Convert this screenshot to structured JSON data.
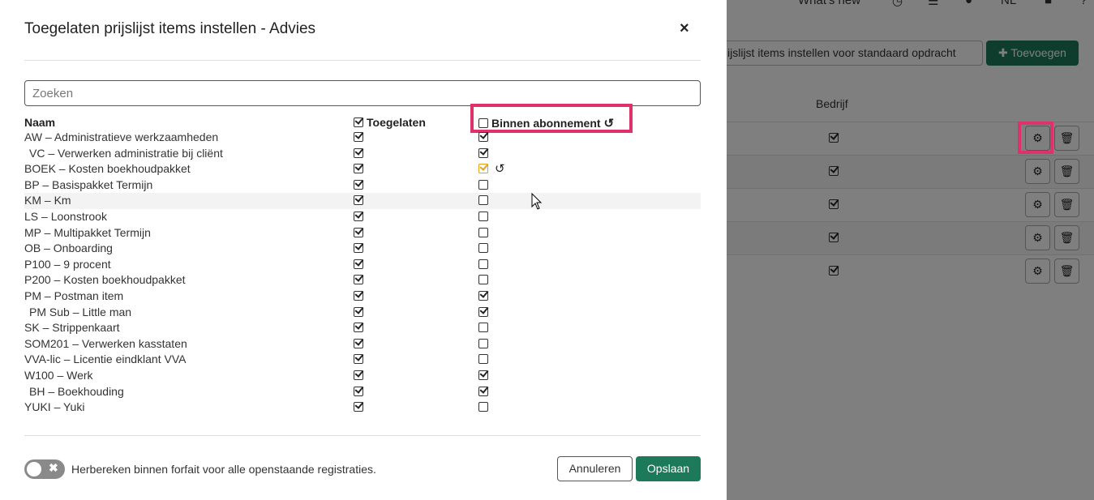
{
  "background": {
    "topnav": {
      "whats_new": "What's new",
      "language": "NL",
      "help": "?"
    },
    "toolbar": {
      "set_items_button": "ijslijst items instellen voor standaard opdracht",
      "add_button": "Toevoegen"
    },
    "table": {
      "company_header": "Bedrijf"
    }
  },
  "modal": {
    "title": "Toegelaten prijslijst items instellen - Advies",
    "close": "×",
    "search_placeholder": "Zoeken",
    "columns": {
      "name": "Naam",
      "allowed": "Toegelaten",
      "within_subscription": "Binnen abonnement"
    },
    "items": [
      {
        "name": "AW – Administratieve werkzaamheden",
        "allowed": true,
        "within": true,
        "child": false
      },
      {
        "name": "VC – Verwerken administratie bij cliënt",
        "allowed": true,
        "within": true,
        "child": true
      },
      {
        "name": "BOEK – Kosten boekhoudpakket",
        "allowed": true,
        "within": true,
        "child": false,
        "changed": true
      },
      {
        "name": "BP – Basispakket Termijn",
        "allowed": true,
        "within": false,
        "child": false
      },
      {
        "name": "KM – Km",
        "allowed": true,
        "within": false,
        "child": false
      },
      {
        "name": "LS – Loonstrook",
        "allowed": true,
        "within": false,
        "child": false
      },
      {
        "name": "MP – Multipakket Termijn",
        "allowed": true,
        "within": false,
        "child": false
      },
      {
        "name": "OB – Onboarding",
        "allowed": true,
        "within": false,
        "child": false
      },
      {
        "name": "P100 – 9 procent",
        "allowed": true,
        "within": false,
        "child": false
      },
      {
        "name": "P200 – Kosten boekhoudpakket",
        "allowed": true,
        "within": false,
        "child": false
      },
      {
        "name": "PM – Postman item",
        "allowed": true,
        "within": true,
        "child": false
      },
      {
        "name": "PM Sub – Little man",
        "allowed": true,
        "within": true,
        "child": true
      },
      {
        "name": "SK – Strippenkaart",
        "allowed": true,
        "within": false,
        "child": false
      },
      {
        "name": "SOM201 – Verwerken kasstaten",
        "allowed": true,
        "within": false,
        "child": false
      },
      {
        "name": "VVA-lic – Licentie eindklant VVA",
        "allowed": true,
        "within": false,
        "child": false
      },
      {
        "name": "W100 – Werk",
        "allowed": true,
        "within": true,
        "child": false
      },
      {
        "name": "BH – Boekhouding",
        "allowed": true,
        "within": true,
        "child": true
      },
      {
        "name": "YUKI – Yuki",
        "allowed": true,
        "within": false,
        "child": false
      }
    ],
    "footer": {
      "toggle_label": "Herbereken binnen forfait voor alle openstaande registraties.",
      "cancel": "Annuleren",
      "save": "Opslaan"
    }
  },
  "colors": {
    "primary_green": "#1c7a5a",
    "highlight": "#e0326a",
    "changed_orange": "#e6a117"
  }
}
